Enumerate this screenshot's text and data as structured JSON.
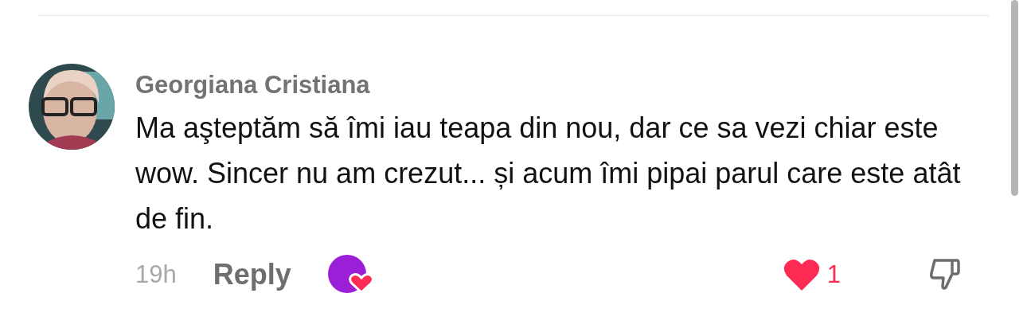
{
  "comment": {
    "author": "Georgiana Cristiana",
    "text": "Ma aşteptăm să îmi iau teapa din nou, dar ce sa vezi chiar este wow. Sincer nu am crezut... și acum îmi pipai parul care este atât de fin.",
    "time": "19h",
    "reply_label": "Reply",
    "liked_by_creator": true,
    "liked": true,
    "likes": "1",
    "disliked": false
  }
}
